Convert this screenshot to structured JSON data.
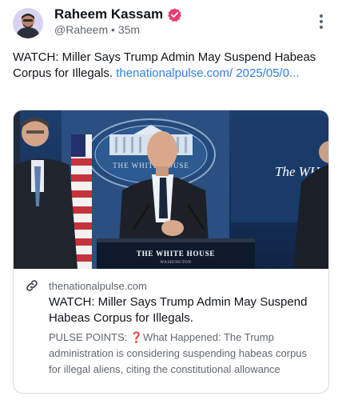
{
  "author": {
    "name": "Raheem Kassam",
    "handle": "@Raheem",
    "separator": "•",
    "time": "35m",
    "verified_color": "#e83d72"
  },
  "post": {
    "text": "WATCH: Miller Says Trump Admin May Suspend Habeas Corpus for Illegals.",
    "link_text": "thenationalpulse.com/ 2025/05/0...",
    "link_color": "#2f7de1"
  },
  "card": {
    "domain": "thenationalpulse.com",
    "title": "WATCH: Miller Says Trump Admin May Suspend Habeas Corpus for Illegals.",
    "description": "PULSE POINTS: ❓What Happened: The Trump administration is considering suspending habeas corpus for illegal aliens, citing the constitutional allowance",
    "image": {
      "seal_text": "THE WHITE HOUSE",
      "podium_text": "THE WHITE HOUSE",
      "podium_subtext": "WASHINGTON",
      "screen_text": "The WHITE"
    }
  },
  "icons": {
    "more": "more-vertical-icon",
    "verified": "verified-badge-icon",
    "link": "link-icon"
  }
}
